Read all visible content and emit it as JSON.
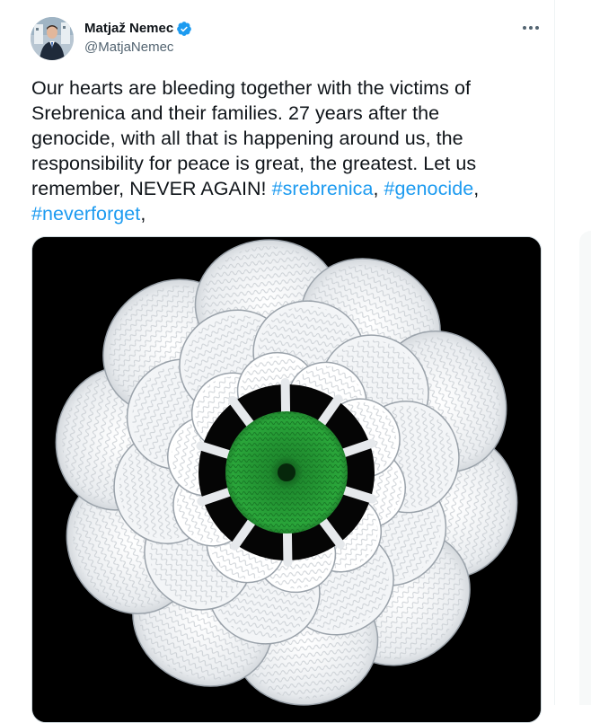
{
  "tweet": {
    "author": {
      "display_name": "Matjaž Nemec",
      "handle": "@MatjaNemec",
      "verified": true
    },
    "text_parts": {
      "line1": "Our hearts are bleeding together with the victims of",
      "line2": "Srebrenica and their families. 27 years after the",
      "line3": "genocide, with all that is happening around us, the",
      "line4": "responsibility for peace is great, the greatest. Let us",
      "line5": "remember, NEVER AGAIN! ",
      "sep1": ", ",
      "sep2": ",",
      "sep3": ","
    },
    "hashtags": [
      "#srebrenica",
      "#genocide",
      "#neverforget"
    ],
    "icons": {
      "more": "more-horizontal-icon",
      "verified": "verified-badge-icon"
    },
    "colors": {
      "link": "#1d9bf0",
      "text": "#0f1419",
      "secondary": "#536471",
      "border": "#cfd9de"
    }
  }
}
